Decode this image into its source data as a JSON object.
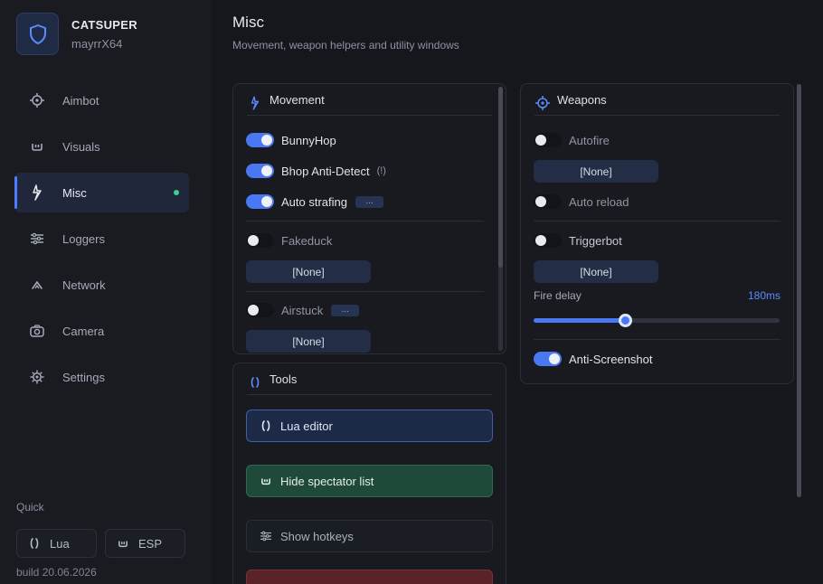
{
  "brand": {
    "name": "CATSUPER",
    "user": "mayrrX64",
    "icon": "shield-icon"
  },
  "nav": [
    {
      "label": "Aimbot",
      "icon": "crosshair-icon"
    },
    {
      "label": "Visuals",
      "icon": "visuals-icon"
    },
    {
      "label": "Misc",
      "icon": "bolt-icon",
      "active": true
    },
    {
      "label": "Loggers",
      "icon": "sliders-icon"
    },
    {
      "label": "Network",
      "icon": "network-icon"
    },
    {
      "label": "Camera",
      "icon": "camera-icon"
    },
    {
      "label": "Settings",
      "icon": "gear-icon"
    }
  ],
  "quick": {
    "label": "Quick",
    "lua": "Lua",
    "esp": "ESP"
  },
  "build": "build 20.06.2026",
  "header": {
    "title": "Misc",
    "subtitle": "Movement, weapon helpers and utility windows"
  },
  "movement": {
    "title": "Movement",
    "bunnyhop": "BunnyHop",
    "bhop_antidetect": "Bhop Anti-Detect",
    "bhop_hint": "(!)",
    "auto_strafing": "Auto strafing",
    "more": "...",
    "fakeduck": "Fakeduck",
    "fakeduck_bind": "[None]",
    "airstuck": "Airstuck",
    "airstuck_bind": "[None]"
  },
  "tools": {
    "title": "Tools",
    "lua_editor": "Lua editor",
    "hide_spectator": "Hide spectator list",
    "show_hotkeys": "Show hotkeys"
  },
  "weapons": {
    "title": "Weapons",
    "autofire": "Autofire",
    "autofire_bind": "[None]",
    "auto_reload": "Auto reload",
    "triggerbot": "Triggerbot",
    "triggerbot_bind": "[None]",
    "fire_delay_label": "Fire delay",
    "fire_delay_value": "180ms",
    "fire_delay_fraction": 0.37,
    "anti_screenshot": "Anti-Screenshot"
  },
  "colors": {
    "accent": "#4a78f2",
    "online": "#3ecf8e",
    "tool_green": "#1f4a3a",
    "tool_red": "#5a2328"
  }
}
